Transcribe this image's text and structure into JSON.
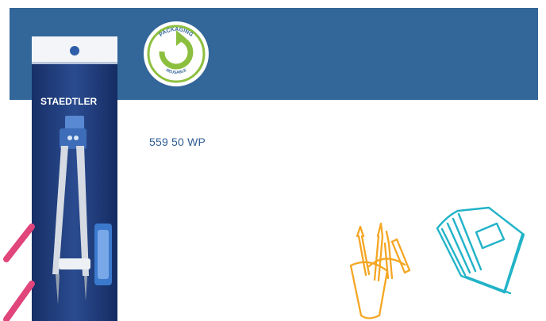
{
  "banner": {
    "color": "#336699"
  },
  "badge": {
    "top_text": "PACKAGING",
    "bottom_text": "REUSABLE",
    "ring_color": "#336699",
    "arrow_color": "#8dbf3f"
  },
  "product": {
    "brand": "STAEDTLER",
    "color": "#1e3a7a",
    "code": "559 50 WP"
  },
  "decorations": {
    "pink_color": "#e0457b",
    "orange_color": "#f5a623",
    "teal_color": "#22b3c8"
  }
}
